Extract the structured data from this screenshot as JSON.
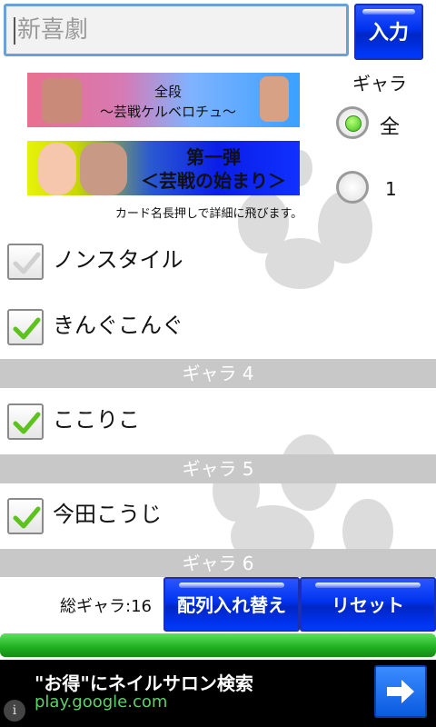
{
  "search": {
    "value": "新喜劇"
  },
  "input_button": {
    "label": "入力"
  },
  "banners": [
    {
      "line1": "全段",
      "line2": "～芸戦ケルベロチュ～"
    },
    {
      "line1": "第一弾",
      "line2": "＜芸戦の始まり＞"
    }
  ],
  "hint": "カード名長押しで詳細に飛びます。",
  "gara_filter": {
    "label": "ギャラ",
    "options": [
      {
        "label": "全",
        "selected": true
      },
      {
        "label": "1",
        "selected": false
      }
    ]
  },
  "items": [
    {
      "label": "ノンスタイル",
      "checked": false
    },
    {
      "label": "きんぐこんぐ",
      "checked": true
    }
  ],
  "sections": [
    {
      "header": "ギャラ 4",
      "items": [
        {
          "label": "ここりこ",
          "checked": true
        }
      ]
    },
    {
      "header": "ギャラ 5",
      "items": [
        {
          "label": "今田こうじ",
          "checked": true
        }
      ]
    },
    {
      "header": "ギャラ 6",
      "items": []
    }
  ],
  "footer": {
    "total": "総ギャラ:16",
    "sort_button": "配列入れ替え",
    "reset_button": "リセット"
  },
  "progress": {
    "fraction": 1.0
  },
  "ad": {
    "title": "\"お得\"にネイルサロン検索",
    "url": "play.google.com",
    "info_icon": "i"
  },
  "colors": {
    "accent_blue": "#0033ee",
    "check_green": "#5cc21e",
    "progress_green": "#1fae1f",
    "section_gray": "#c8c8c8"
  }
}
